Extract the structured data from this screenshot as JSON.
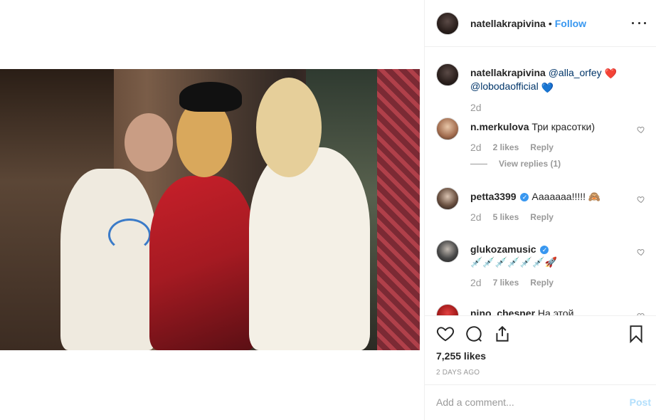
{
  "post": {
    "author": "natellakrapivina",
    "follow_label": "Follow",
    "separator": "•",
    "caption": {
      "author": "natellakrapivina",
      "mention1": "@alla_orfey",
      "mention2": "@lobodaofficial",
      "emoji1": "❤️",
      "emoji2": "💙",
      "age": "2d"
    },
    "comments": [
      {
        "user": "n.merkulova",
        "text": "Три красотки)",
        "age": "2d",
        "likes": "2 likes",
        "reply": "Reply",
        "view_replies": "View replies (1)"
      },
      {
        "user": "petta3399",
        "verified": true,
        "text": "Ааааааа!!!!! 🙈",
        "age": "2d",
        "likes": "5 likes",
        "reply": "Reply"
      },
      {
        "user": "glukozamusic",
        "verified": true,
        "text": "💉💉💉💉💉💉🚀",
        "age": "2d",
        "likes": "7 likes",
        "reply": "Reply"
      },
      {
        "user": "nino_chesner",
        "text": "На этой"
      }
    ],
    "likes_total": "7,255 likes",
    "time_ago": "2 DAYS AGO",
    "add_comment_placeholder": "Add a comment...",
    "post_button": "Post"
  },
  "icons": {
    "more": "more-options-icon",
    "like": "heart-icon",
    "comment": "comment-icon",
    "share": "share-icon",
    "save": "bookmark-icon"
  },
  "colors": {
    "link_blue": "#3897f0",
    "mention_blue": "#003569",
    "muted_text": "#999999",
    "border": "#efefef",
    "post_disabled": "#b2dffc"
  }
}
